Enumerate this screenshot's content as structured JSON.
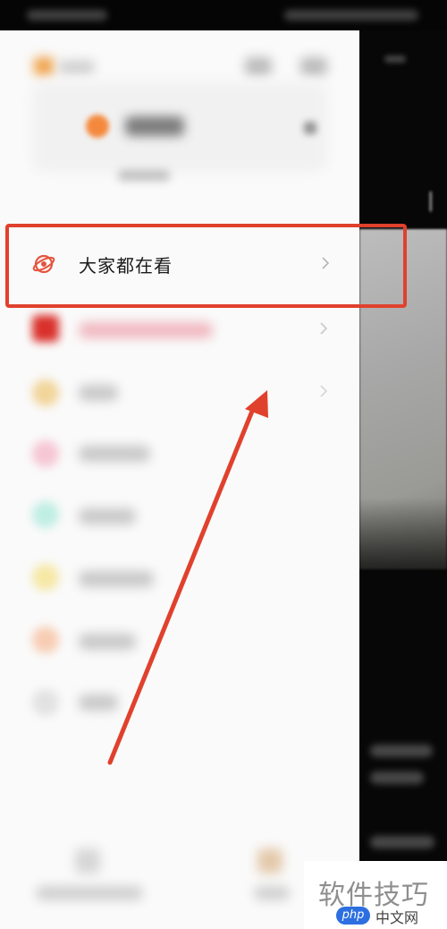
{
  "menu": {
    "highlighted_item": {
      "label": "大家都在看",
      "icon": "planet-icon"
    }
  },
  "annotation": {
    "box_color": "#e0412d",
    "arrow_color": "#e0412d"
  },
  "watermark": {
    "title": "软件技巧",
    "badge": "php",
    "site": "中文网"
  }
}
